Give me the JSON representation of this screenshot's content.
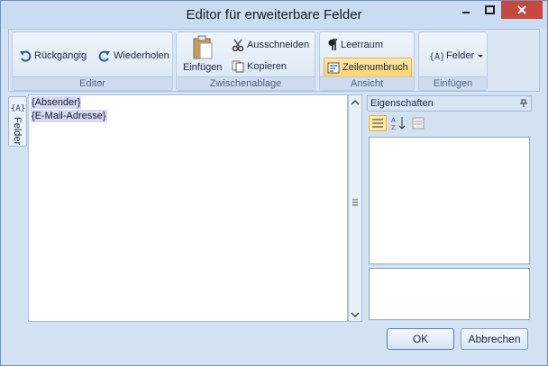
{
  "window": {
    "title": "Editor für erweiterbare Felder"
  },
  "ribbon": {
    "groups": {
      "editor": {
        "label": "Editor",
        "undo": "Rückgängig",
        "redo": "Wiederholen"
      },
      "clipboard": {
        "label": "Zwischenablage",
        "paste": "Einfügen",
        "cut": "Ausschneiden",
        "copy": "Kopieren"
      },
      "view": {
        "label": "Ansicht",
        "whitespace": "Leerraum",
        "wordwrap": "Zeilenumbruch"
      },
      "insert": {
        "label": "Einfügen",
        "fields": "Felder"
      }
    }
  },
  "sidebar": {
    "tab_label": "Felder"
  },
  "editor": {
    "lines": [
      "{Absender}",
      "{E-Mail-Adresse}"
    ]
  },
  "properties": {
    "title": "Eigenschaften"
  },
  "dialog": {
    "ok": "OK",
    "cancel": "Abbrechen"
  },
  "colors": {
    "accent": "#ffd46b",
    "close": "#c7483f",
    "field_highlight": "#d6d8f7"
  }
}
